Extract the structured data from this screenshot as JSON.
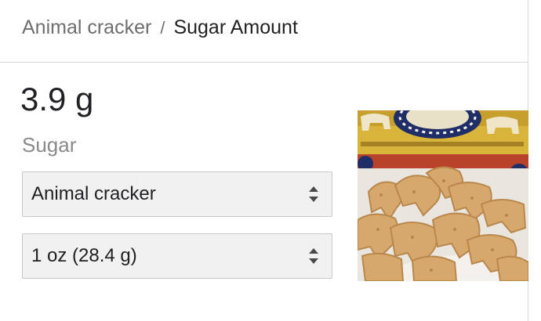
{
  "breadcrumb": {
    "parent": "Animal cracker",
    "separator": "/",
    "current": "Sugar Amount"
  },
  "result": {
    "amount": "3.9 g",
    "nutrient": "Sugar"
  },
  "selectors": {
    "food": {
      "selected": "Animal cracker"
    },
    "serving": {
      "selected": "1 oz (28.4 g)"
    }
  },
  "image": {
    "subject": "animal crackers photo",
    "colors": {
      "box_yellow": "#d8b43a",
      "box_navy": "#1f2e66",
      "cracker_tan": "#d7a86b",
      "bowl_white": "#f4f1ec"
    }
  },
  "icons": {
    "select_arrows": "up-down-arrows-icon"
  }
}
